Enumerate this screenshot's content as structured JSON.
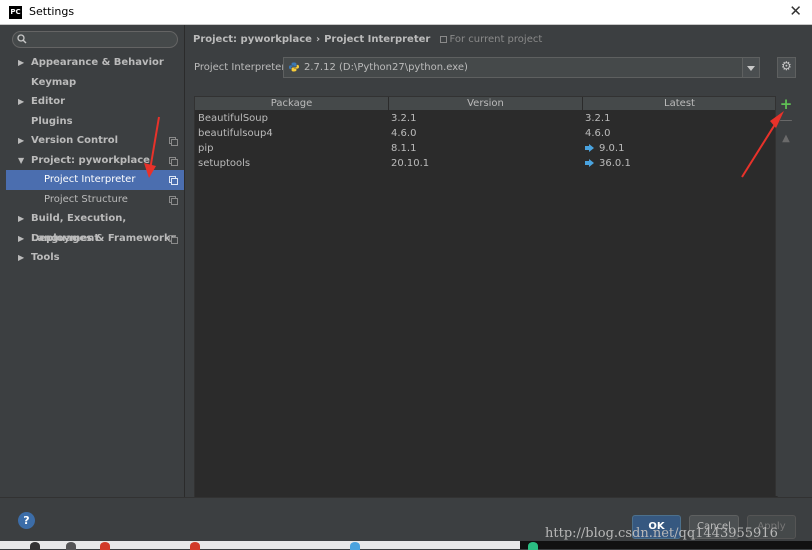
{
  "window": {
    "title": "Settings",
    "app_badge": "PC",
    "close_glyph": "✕"
  },
  "sidebar": {
    "search_placeholder": "",
    "items": [
      {
        "label": "Appearance & Behavior",
        "expand": "▶",
        "level": 0
      },
      {
        "label": "Keymap",
        "expand": "",
        "level": 0
      },
      {
        "label": "Editor",
        "expand": "▶",
        "level": 0
      },
      {
        "label": "Plugins",
        "expand": "",
        "level": 0
      },
      {
        "label": "Version Control",
        "expand": "▶",
        "level": 0,
        "copy": true
      },
      {
        "label": "Project: pyworkplace",
        "expand": "▼",
        "level": 0,
        "copy": true
      },
      {
        "label": "Project Interpreter",
        "expand": "",
        "level": 1,
        "copy": true,
        "selected": true
      },
      {
        "label": "Project Structure",
        "expand": "",
        "level": 1,
        "copy": true
      },
      {
        "label": "Build, Execution, Deployment",
        "expand": "▶",
        "level": 0
      },
      {
        "label": "Languages & Frameworks",
        "expand": "▶",
        "level": 0,
        "copy": true
      },
      {
        "label": "Tools",
        "expand": "▶",
        "level": 0
      }
    ]
  },
  "header": {
    "crumb_parent": "Project: pyworkplace",
    "crumb_sep": "›",
    "crumb_current": "Project Interpreter",
    "note": "For current project"
  },
  "interpreter": {
    "label": "Project Interpreter:",
    "value": "2.7.12 (D:\\Python27\\python.exe)"
  },
  "packages": {
    "columns": [
      "Package",
      "Version",
      "Latest"
    ],
    "rows": [
      {
        "package": "BeautifulSoup",
        "version": "3.2.1",
        "latest": "3.2.1",
        "upgrade": false
      },
      {
        "package": "beautifulsoup4",
        "version": "4.6.0",
        "latest": "4.6.0",
        "upgrade": false
      },
      {
        "package": "pip",
        "version": "8.1.1",
        "latest": "9.0.1",
        "upgrade": true
      },
      {
        "package": "setuptools",
        "version": "20.10.1",
        "latest": "36.0.1",
        "upgrade": true
      }
    ]
  },
  "tools": {
    "add": "+",
    "remove": "—",
    "upgrade": "▲"
  },
  "buttons": {
    "ok": "OK",
    "cancel": "Cancel",
    "apply": "Apply",
    "help": "?"
  },
  "watermark": "http://blog.csdn.net/qq1443955916",
  "colors": {
    "selection": "#4b6eaf",
    "accent_ok": "#365880",
    "add_green": "#5fbf54",
    "annotation_red": "#e8322a",
    "upgrade_blue": "#4aa3df"
  }
}
